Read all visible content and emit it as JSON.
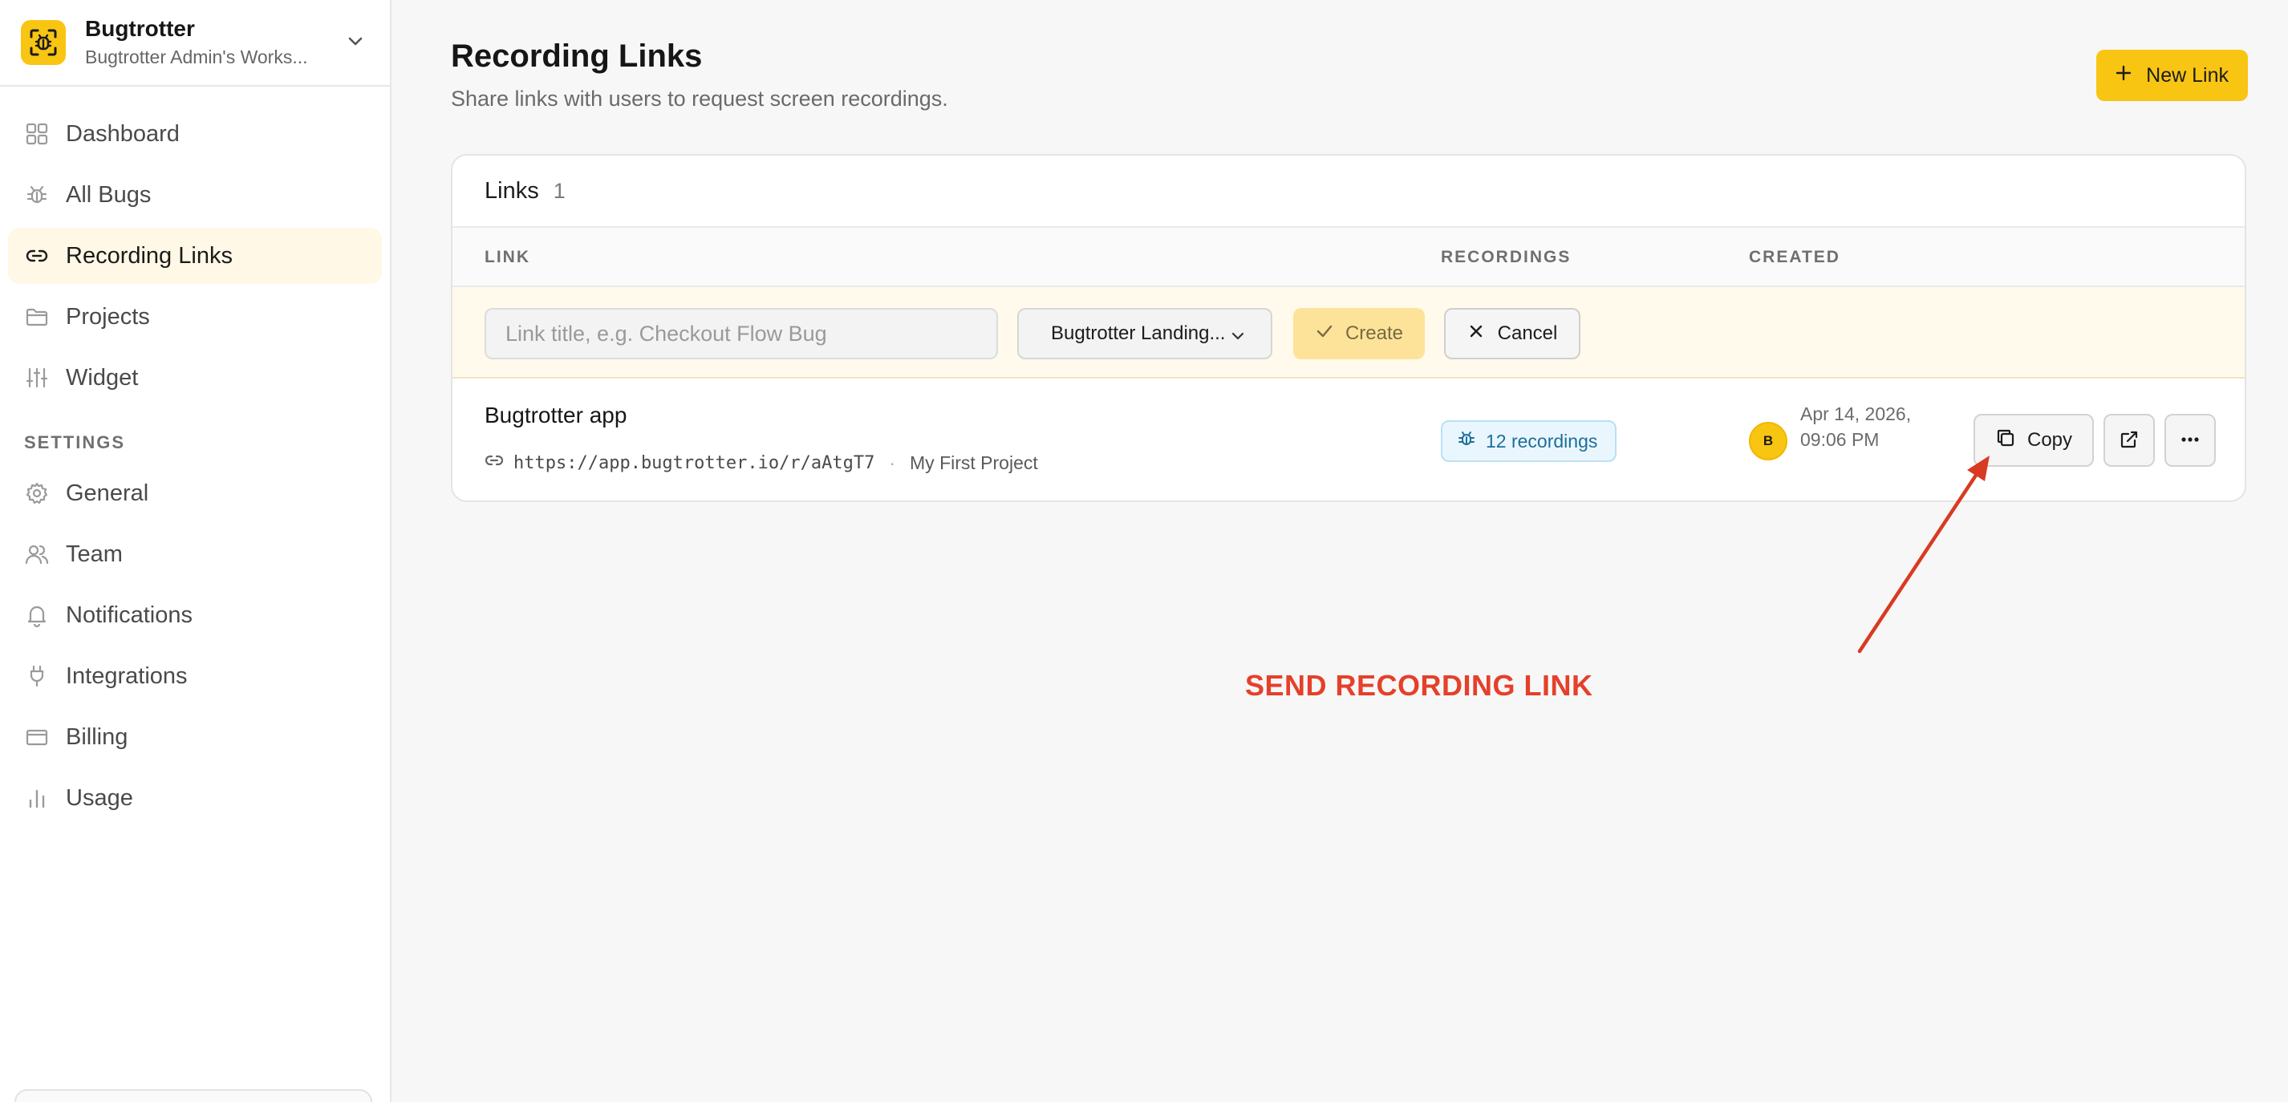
{
  "workspace": {
    "name": "Bugtrotter",
    "subtitle": "Bugtrotter Admin's Works..."
  },
  "sidebar": {
    "main_items": [
      {
        "label": "Dashboard",
        "icon": "grid-icon"
      },
      {
        "label": "All Bugs",
        "icon": "bug-icon"
      },
      {
        "label": "Recording Links",
        "icon": "link-icon",
        "active": true
      },
      {
        "label": "Projects",
        "icon": "folder-icon"
      },
      {
        "label": "Widget",
        "icon": "sliders-icon"
      }
    ],
    "settings_label": "SETTINGS",
    "settings_items": [
      {
        "label": "General",
        "icon": "gear-icon"
      },
      {
        "label": "Team",
        "icon": "users-icon"
      },
      {
        "label": "Notifications",
        "icon": "bell-icon"
      },
      {
        "label": "Integrations",
        "icon": "plug-icon"
      },
      {
        "label": "Billing",
        "icon": "credit-card-icon"
      },
      {
        "label": "Usage",
        "icon": "bar-chart-icon"
      }
    ]
  },
  "page": {
    "title": "Recording Links",
    "subtitle": "Share links with users to request screen recordings.",
    "new_link_label": "New Link"
  },
  "card": {
    "title": "Links",
    "count": "1",
    "columns": {
      "link": "LINK",
      "recordings": "RECORDINGS",
      "created": "CREATED"
    },
    "create_row": {
      "title_placeholder": "Link title, e.g. Checkout Flow Bug",
      "title_value": "",
      "project_selected": "Bugtrotter Landing...",
      "create_label": "Create",
      "cancel_label": "Cancel"
    },
    "rows": [
      {
        "title": "Bugtrotter app",
        "url": "https://app.bugtrotter.io/r/aAtgT7",
        "project": "My First Project",
        "recordings": "12 recordings",
        "avatar_initial": "B",
        "created": "Apr 14, 2026, 09:06 PM",
        "copy_label": "Copy"
      }
    ]
  },
  "annotation": {
    "text": "SEND RECORDING LINK",
    "color": "#e5402a"
  },
  "colors": {
    "accent": "#f9c513",
    "badge_bg": "#eaf6fd",
    "badge_text": "#1c6e9a"
  }
}
